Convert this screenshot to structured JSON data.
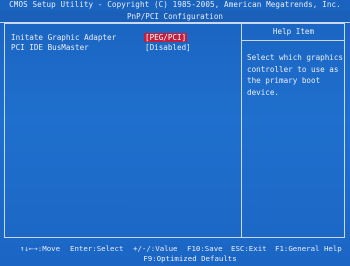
{
  "header": {
    "title": "CMOS Setup Utility - Copyright (C) 1985-2005, American Megatrends, Inc.",
    "page": "PnP/PCI Configuration"
  },
  "options": [
    {
      "label": "Initate Graphic Adapter",
      "value": "[PEG/PCI]",
      "selected": true
    },
    {
      "label": "PCI IDE BusMaster",
      "value": "[Disabled]",
      "selected": false
    }
  ],
  "help": {
    "title": "Help Item",
    "lines": [
      "Select which graphics",
      "controller to use as",
      "the primary boot",
      "device."
    ]
  },
  "footer": {
    "keys": [
      "↑↓←→:Move",
      "Enter:Select",
      "+/-/:Value",
      "F10:Save",
      "ESC:Exit",
      "F1:General Help"
    ],
    "line2": "F9:Optimized Defaults"
  },
  "colors": {
    "background": "#1f6fce",
    "selected_highlight": "#c21f3e",
    "text": "#e8edf6"
  }
}
